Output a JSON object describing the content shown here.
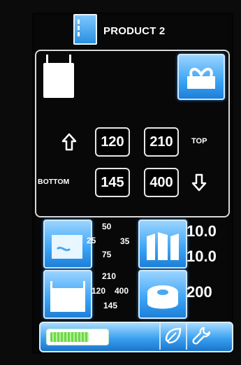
{
  "header": {
    "title": "PRODUCT 2",
    "icon": "product-roll-icon"
  },
  "panel": {
    "top_label": "TOP",
    "bottom_label": "BOTTOM",
    "top_values": [
      "120",
      "210"
    ],
    "bottom_values": [
      "145",
      "400"
    ],
    "icons": {
      "bag": "bag-icon",
      "ribbon": "ribbon-icon",
      "up": "arrow-up-icon",
      "down": "arrow-down-icon"
    }
  },
  "tiles": {
    "seal": {
      "icon": "seal-tile-icon",
      "values": [
        "50",
        "25",
        "35",
        "75"
      ]
    },
    "fill": {
      "icon": "fill-tile-icon",
      "values": [
        "10.0",
        "10.0"
      ]
    },
    "bag": {
      "icon": "bag-dimensions-icon",
      "values": [
        "210",
        "120",
        "400",
        "145"
      ]
    },
    "roll": {
      "icon": "roll-tile-icon",
      "value": "200"
    }
  },
  "bottom_bar": {
    "battery_level": 0.7,
    "icons": [
      "leaf-icon",
      "wrench-icon"
    ]
  },
  "colors": {
    "accent": "#3ba3f5",
    "background": "#0b0b0b",
    "battery": "#6ed84b"
  }
}
